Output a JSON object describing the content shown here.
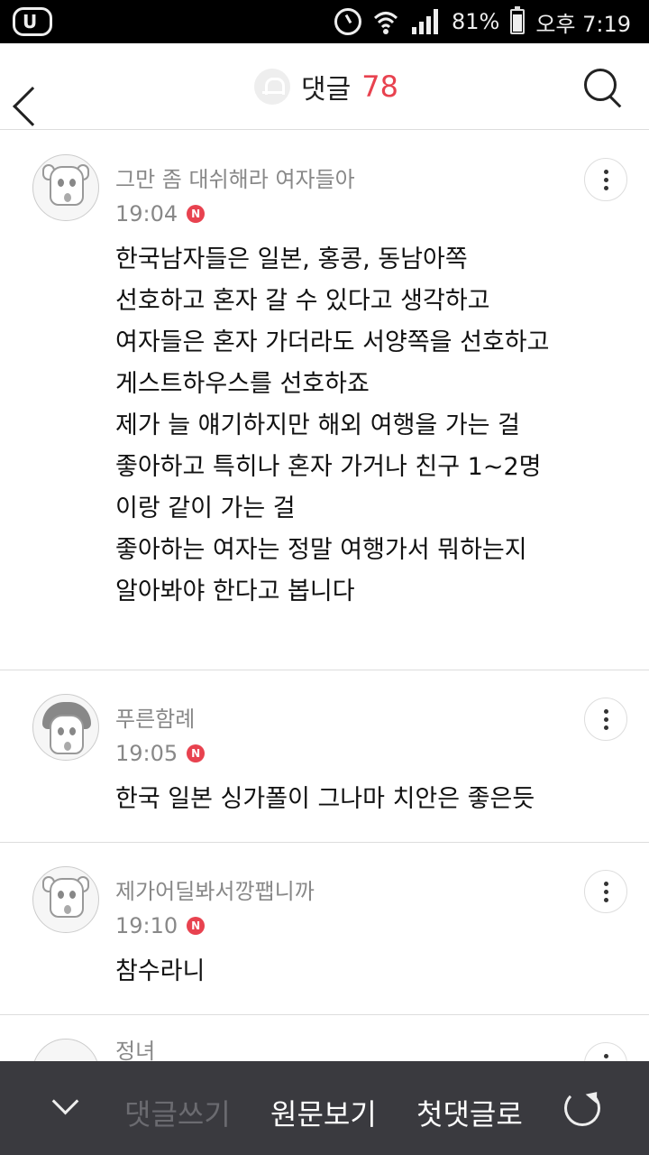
{
  "status_bar": {
    "battery": "81%",
    "time": "오후 7:19"
  },
  "header": {
    "title": "댓글",
    "count": "78"
  },
  "comments": [
    {
      "nickname": "그만 좀 대쉬해라 여자들아",
      "time": "19:04",
      "badge": "N",
      "lines": [
        "한국남자들은 일본, 홍콩, 동남아쪽",
        "선호하고 혼자 갈 수 있다고 생각하고",
        "여자들은 혼자 가더라도 서양쪽을 선호하고",
        "게스트하우스를 선호하죠",
        "제가 늘 얘기하지만 해외 여행을 가는 걸",
        "좋아하고 특히나 혼자 가거나 친구 1~2명",
        "이랑 같이 가는 걸",
        "좋아하는 여자는 정말 여행가서 뭐하는지",
        "알아봐야 한다고 봅니다"
      ]
    },
    {
      "nickname": "푸른함례",
      "time": "19:05",
      "badge": "N",
      "lines": [
        "한국 일본 싱가폴이 그나마 치안은 좋은듯"
      ]
    },
    {
      "nickname": "제가어딜봐서깡팹니까",
      "time": "19:10",
      "badge": "N",
      "lines": [
        "참수라니"
      ]
    },
    {
      "nickname": "정녀"
    }
  ],
  "bottom_bar": {
    "write_label": "댓글쓰기",
    "original_label": "원문보기",
    "first_label": "첫댓글로"
  },
  "colors": {
    "accent": "#e8424f",
    "bottom_bar_bg": "#3a3a3f"
  }
}
